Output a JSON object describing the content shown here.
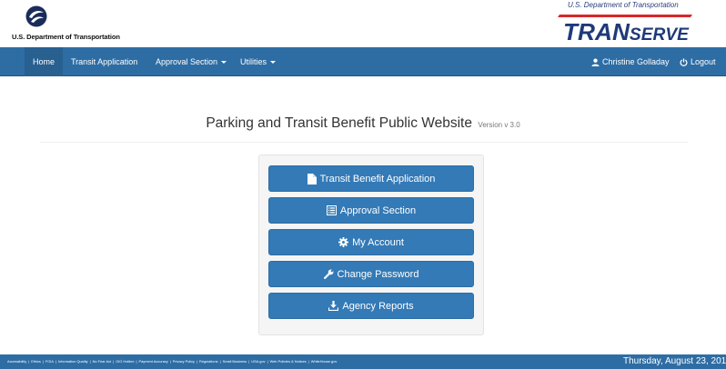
{
  "header": {
    "agency_name": "U.S. Department of Transportation",
    "transerve_superscript": "U.S. Department of Transportation",
    "transerve_logo_text": "TRANSERVE"
  },
  "nav": {
    "items": [
      {
        "label": "Home"
      },
      {
        "label": "Transit Application"
      },
      {
        "label": "Approval Section"
      },
      {
        "label": "Utilities"
      }
    ],
    "user_name": "Christine Golladay",
    "logout_label": "Logout"
  },
  "main": {
    "title": "Parking and Transit Benefit Public Website",
    "version": "Version v 3.0",
    "buttons": [
      {
        "label": "Transit Benefit Application",
        "icon": "file-icon"
      },
      {
        "label": "Approval Section",
        "icon": "list-icon"
      },
      {
        "label": "My Account",
        "icon": "gear-icon"
      },
      {
        "label": "Change Password",
        "icon": "wrench-icon"
      },
      {
        "label": "Agency Reports",
        "icon": "download-icon"
      }
    ]
  },
  "footer": {
    "links": [
      "Accessibility",
      "Ethics",
      "FOIA",
      "Information Quality",
      "No Fear Act",
      "OIG Hotline",
      "Payment Accuracy",
      "Privacy Policy",
      "Regulations",
      "Small Business",
      "USA.gov",
      "Web Policies & Notices",
      "WhiteHouse.gov"
    ],
    "date": "Thursday, August 23, 201"
  },
  "colors": {
    "navbar": "#2e6da4",
    "nav_active": "#286090",
    "button": "#337ab7",
    "well": "#f5f5f5",
    "brand_navy": "#1f3a7a",
    "brand_red": "#d9252a"
  }
}
